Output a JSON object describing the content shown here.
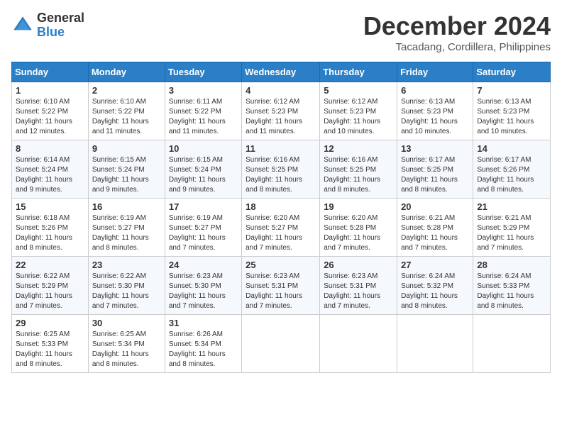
{
  "header": {
    "logo_general": "General",
    "logo_blue": "Blue",
    "month_title": "December 2024",
    "location": "Tacadang, Cordillera, Philippines"
  },
  "weekdays": [
    "Sunday",
    "Monday",
    "Tuesday",
    "Wednesday",
    "Thursday",
    "Friday",
    "Saturday"
  ],
  "weeks": [
    [
      {
        "day": "1",
        "sunrise": "6:10 AM",
        "sunset": "5:22 PM",
        "daylight": "11 hours and 12 minutes."
      },
      {
        "day": "2",
        "sunrise": "6:10 AM",
        "sunset": "5:22 PM",
        "daylight": "11 hours and 11 minutes."
      },
      {
        "day": "3",
        "sunrise": "6:11 AM",
        "sunset": "5:22 PM",
        "daylight": "11 hours and 11 minutes."
      },
      {
        "day": "4",
        "sunrise": "6:12 AM",
        "sunset": "5:23 PM",
        "daylight": "11 hours and 11 minutes."
      },
      {
        "day": "5",
        "sunrise": "6:12 AM",
        "sunset": "5:23 PM",
        "daylight": "11 hours and 10 minutes."
      },
      {
        "day": "6",
        "sunrise": "6:13 AM",
        "sunset": "5:23 PM",
        "daylight": "11 hours and 10 minutes."
      },
      {
        "day": "7",
        "sunrise": "6:13 AM",
        "sunset": "5:23 PM",
        "daylight": "11 hours and 10 minutes."
      }
    ],
    [
      {
        "day": "8",
        "sunrise": "6:14 AM",
        "sunset": "5:24 PM",
        "daylight": "11 hours and 9 minutes."
      },
      {
        "day": "9",
        "sunrise": "6:15 AM",
        "sunset": "5:24 PM",
        "daylight": "11 hours and 9 minutes."
      },
      {
        "day": "10",
        "sunrise": "6:15 AM",
        "sunset": "5:24 PM",
        "daylight": "11 hours and 9 minutes."
      },
      {
        "day": "11",
        "sunrise": "6:16 AM",
        "sunset": "5:25 PM",
        "daylight": "11 hours and 8 minutes."
      },
      {
        "day": "12",
        "sunrise": "6:16 AM",
        "sunset": "5:25 PM",
        "daylight": "11 hours and 8 minutes."
      },
      {
        "day": "13",
        "sunrise": "6:17 AM",
        "sunset": "5:25 PM",
        "daylight": "11 hours and 8 minutes."
      },
      {
        "day": "14",
        "sunrise": "6:17 AM",
        "sunset": "5:26 PM",
        "daylight": "11 hours and 8 minutes."
      }
    ],
    [
      {
        "day": "15",
        "sunrise": "6:18 AM",
        "sunset": "5:26 PM",
        "daylight": "11 hours and 8 minutes."
      },
      {
        "day": "16",
        "sunrise": "6:19 AM",
        "sunset": "5:27 PM",
        "daylight": "11 hours and 8 minutes."
      },
      {
        "day": "17",
        "sunrise": "6:19 AM",
        "sunset": "5:27 PM",
        "daylight": "11 hours and 7 minutes."
      },
      {
        "day": "18",
        "sunrise": "6:20 AM",
        "sunset": "5:27 PM",
        "daylight": "11 hours and 7 minutes."
      },
      {
        "day": "19",
        "sunrise": "6:20 AM",
        "sunset": "5:28 PM",
        "daylight": "11 hours and 7 minutes."
      },
      {
        "day": "20",
        "sunrise": "6:21 AM",
        "sunset": "5:28 PM",
        "daylight": "11 hours and 7 minutes."
      },
      {
        "day": "21",
        "sunrise": "6:21 AM",
        "sunset": "5:29 PM",
        "daylight": "11 hours and 7 minutes."
      }
    ],
    [
      {
        "day": "22",
        "sunrise": "6:22 AM",
        "sunset": "5:29 PM",
        "daylight": "11 hours and 7 minutes."
      },
      {
        "day": "23",
        "sunrise": "6:22 AM",
        "sunset": "5:30 PM",
        "daylight": "11 hours and 7 minutes."
      },
      {
        "day": "24",
        "sunrise": "6:23 AM",
        "sunset": "5:30 PM",
        "daylight": "11 hours and 7 minutes."
      },
      {
        "day": "25",
        "sunrise": "6:23 AM",
        "sunset": "5:31 PM",
        "daylight": "11 hours and 7 minutes."
      },
      {
        "day": "26",
        "sunrise": "6:23 AM",
        "sunset": "5:31 PM",
        "daylight": "11 hours and 7 minutes."
      },
      {
        "day": "27",
        "sunrise": "6:24 AM",
        "sunset": "5:32 PM",
        "daylight": "11 hours and 8 minutes."
      },
      {
        "day": "28",
        "sunrise": "6:24 AM",
        "sunset": "5:33 PM",
        "daylight": "11 hours and 8 minutes."
      }
    ],
    [
      {
        "day": "29",
        "sunrise": "6:25 AM",
        "sunset": "5:33 PM",
        "daylight": "11 hours and 8 minutes."
      },
      {
        "day": "30",
        "sunrise": "6:25 AM",
        "sunset": "5:34 PM",
        "daylight": "11 hours and 8 minutes."
      },
      {
        "day": "31",
        "sunrise": "6:26 AM",
        "sunset": "5:34 PM",
        "daylight": "11 hours and 8 minutes."
      },
      null,
      null,
      null,
      null
    ]
  ]
}
